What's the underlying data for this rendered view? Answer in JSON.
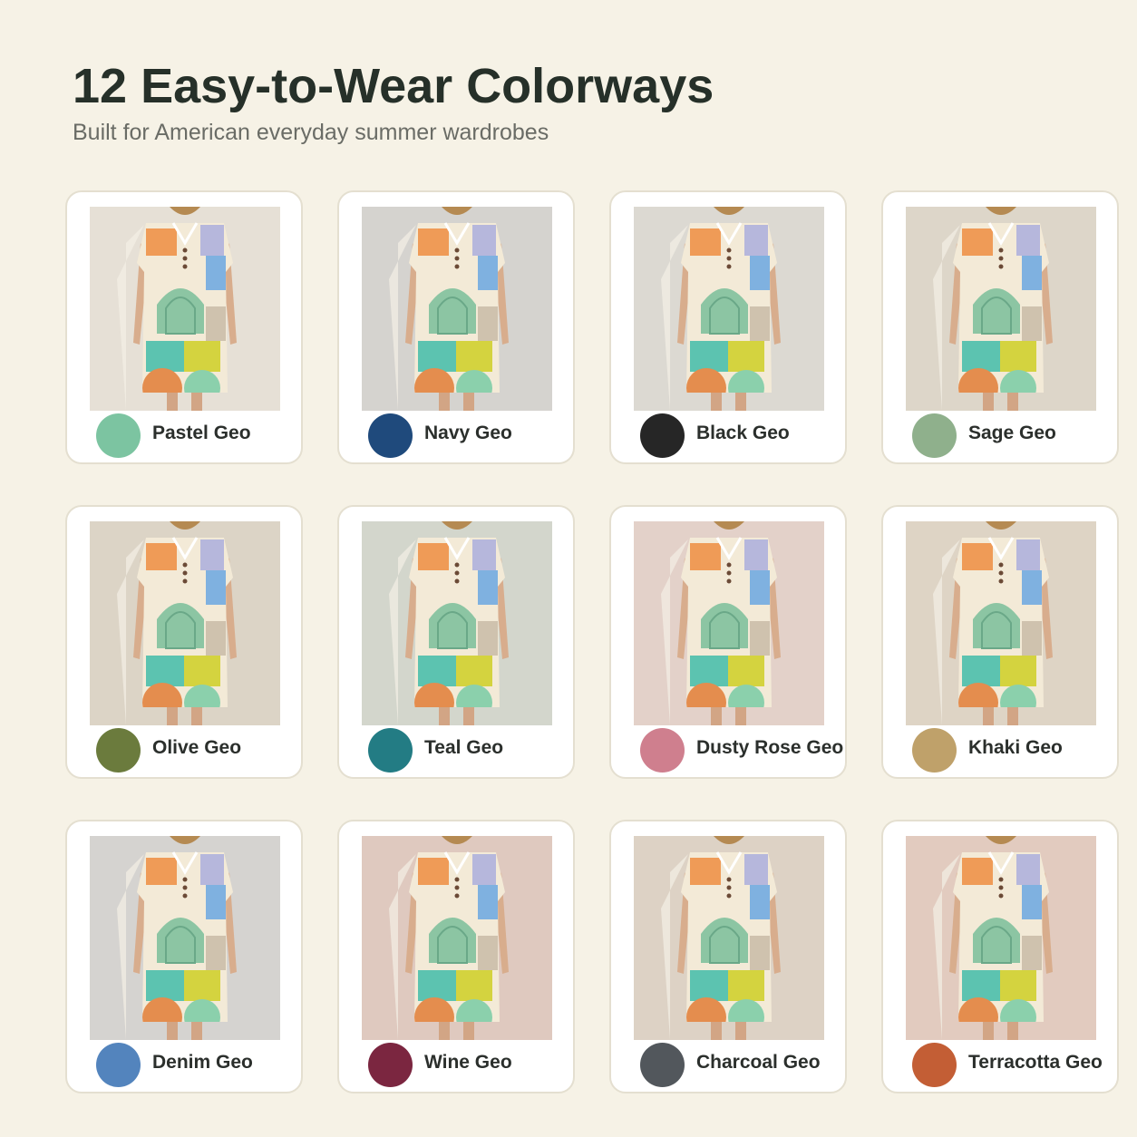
{
  "header": {
    "title": "12 Easy-to-Wear Colorways",
    "subtitle": "Built for American everyday summer wardrobes"
  },
  "colorways": [
    {
      "label": "Pastel Geo",
      "swatch": "#7cc4a1",
      "backdrop": "#e6e0d6"
    },
    {
      "label": "Navy Geo",
      "swatch": "#1f4a7c",
      "backdrop": "#d5d3cf"
    },
    {
      "label": "Black Geo",
      "swatch": "#262626",
      "backdrop": "#dcd9d2"
    },
    {
      "label": "Sage Geo",
      "swatch": "#8fb08c",
      "backdrop": "#ddd6c9"
    },
    {
      "label": "Olive Geo",
      "swatch": "#6b7b3d",
      "backdrop": "#dcd4c6"
    },
    {
      "label": "Teal Geo",
      "swatch": "#237c84",
      "backdrop": "#d3d6cc"
    },
    {
      "label": "Dusty Rose Geo",
      "swatch": "#cf7f8e",
      "backdrop": "#e3d1c9"
    },
    {
      "label": "Khaki Geo",
      "swatch": "#bfa16a",
      "backdrop": "#ded4c5"
    },
    {
      "label": "Denim Geo",
      "swatch": "#5384bd",
      "backdrop": "#d5d3d0"
    },
    {
      "label": "Wine Geo",
      "swatch": "#7b2640",
      "backdrop": "#dfc9bf"
    },
    {
      "label": "Charcoal Geo",
      "swatch": "#52575c",
      "backdrop": "#ddd2c5"
    },
    {
      "label": "Terracotta Geo",
      "swatch": "#c35e35",
      "backdrop": "#e2cbbf"
    }
  ]
}
